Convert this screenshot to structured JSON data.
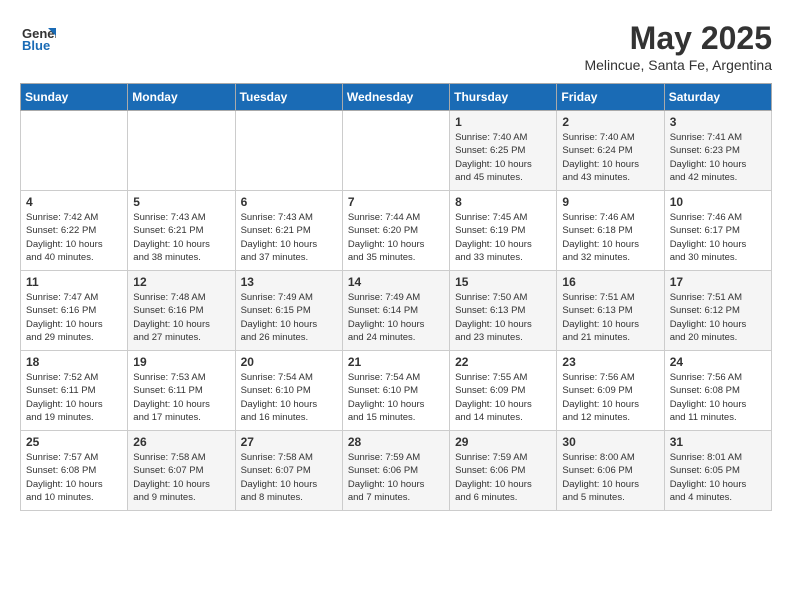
{
  "header": {
    "logo_general": "General",
    "logo_blue": "Blue",
    "title": "May 2025",
    "location": "Melincue, Santa Fe, Argentina"
  },
  "weekdays": [
    "Sunday",
    "Monday",
    "Tuesday",
    "Wednesday",
    "Thursday",
    "Friday",
    "Saturday"
  ],
  "weeks": [
    [
      {
        "day": "",
        "info": ""
      },
      {
        "day": "",
        "info": ""
      },
      {
        "day": "",
        "info": ""
      },
      {
        "day": "",
        "info": ""
      },
      {
        "day": "1",
        "info": "Sunrise: 7:40 AM\nSunset: 6:25 PM\nDaylight: 10 hours\nand 45 minutes."
      },
      {
        "day": "2",
        "info": "Sunrise: 7:40 AM\nSunset: 6:24 PM\nDaylight: 10 hours\nand 43 minutes."
      },
      {
        "day": "3",
        "info": "Sunrise: 7:41 AM\nSunset: 6:23 PM\nDaylight: 10 hours\nand 42 minutes."
      }
    ],
    [
      {
        "day": "4",
        "info": "Sunrise: 7:42 AM\nSunset: 6:22 PM\nDaylight: 10 hours\nand 40 minutes."
      },
      {
        "day": "5",
        "info": "Sunrise: 7:43 AM\nSunset: 6:21 PM\nDaylight: 10 hours\nand 38 minutes."
      },
      {
        "day": "6",
        "info": "Sunrise: 7:43 AM\nSunset: 6:21 PM\nDaylight: 10 hours\nand 37 minutes."
      },
      {
        "day": "7",
        "info": "Sunrise: 7:44 AM\nSunset: 6:20 PM\nDaylight: 10 hours\nand 35 minutes."
      },
      {
        "day": "8",
        "info": "Sunrise: 7:45 AM\nSunset: 6:19 PM\nDaylight: 10 hours\nand 33 minutes."
      },
      {
        "day": "9",
        "info": "Sunrise: 7:46 AM\nSunset: 6:18 PM\nDaylight: 10 hours\nand 32 minutes."
      },
      {
        "day": "10",
        "info": "Sunrise: 7:46 AM\nSunset: 6:17 PM\nDaylight: 10 hours\nand 30 minutes."
      }
    ],
    [
      {
        "day": "11",
        "info": "Sunrise: 7:47 AM\nSunset: 6:16 PM\nDaylight: 10 hours\nand 29 minutes."
      },
      {
        "day": "12",
        "info": "Sunrise: 7:48 AM\nSunset: 6:16 PM\nDaylight: 10 hours\nand 27 minutes."
      },
      {
        "day": "13",
        "info": "Sunrise: 7:49 AM\nSunset: 6:15 PM\nDaylight: 10 hours\nand 26 minutes."
      },
      {
        "day": "14",
        "info": "Sunrise: 7:49 AM\nSunset: 6:14 PM\nDaylight: 10 hours\nand 24 minutes."
      },
      {
        "day": "15",
        "info": "Sunrise: 7:50 AM\nSunset: 6:13 PM\nDaylight: 10 hours\nand 23 minutes."
      },
      {
        "day": "16",
        "info": "Sunrise: 7:51 AM\nSunset: 6:13 PM\nDaylight: 10 hours\nand 21 minutes."
      },
      {
        "day": "17",
        "info": "Sunrise: 7:51 AM\nSunset: 6:12 PM\nDaylight: 10 hours\nand 20 minutes."
      }
    ],
    [
      {
        "day": "18",
        "info": "Sunrise: 7:52 AM\nSunset: 6:11 PM\nDaylight: 10 hours\nand 19 minutes."
      },
      {
        "day": "19",
        "info": "Sunrise: 7:53 AM\nSunset: 6:11 PM\nDaylight: 10 hours\nand 17 minutes."
      },
      {
        "day": "20",
        "info": "Sunrise: 7:54 AM\nSunset: 6:10 PM\nDaylight: 10 hours\nand 16 minutes."
      },
      {
        "day": "21",
        "info": "Sunrise: 7:54 AM\nSunset: 6:10 PM\nDaylight: 10 hours\nand 15 minutes."
      },
      {
        "day": "22",
        "info": "Sunrise: 7:55 AM\nSunset: 6:09 PM\nDaylight: 10 hours\nand 14 minutes."
      },
      {
        "day": "23",
        "info": "Sunrise: 7:56 AM\nSunset: 6:09 PM\nDaylight: 10 hours\nand 12 minutes."
      },
      {
        "day": "24",
        "info": "Sunrise: 7:56 AM\nSunset: 6:08 PM\nDaylight: 10 hours\nand 11 minutes."
      }
    ],
    [
      {
        "day": "25",
        "info": "Sunrise: 7:57 AM\nSunset: 6:08 PM\nDaylight: 10 hours\nand 10 minutes."
      },
      {
        "day": "26",
        "info": "Sunrise: 7:58 AM\nSunset: 6:07 PM\nDaylight: 10 hours\nand 9 minutes."
      },
      {
        "day": "27",
        "info": "Sunrise: 7:58 AM\nSunset: 6:07 PM\nDaylight: 10 hours\nand 8 minutes."
      },
      {
        "day": "28",
        "info": "Sunrise: 7:59 AM\nSunset: 6:06 PM\nDaylight: 10 hours\nand 7 minutes."
      },
      {
        "day": "29",
        "info": "Sunrise: 7:59 AM\nSunset: 6:06 PM\nDaylight: 10 hours\nand 6 minutes."
      },
      {
        "day": "30",
        "info": "Sunrise: 8:00 AM\nSunset: 6:06 PM\nDaylight: 10 hours\nand 5 minutes."
      },
      {
        "day": "31",
        "info": "Sunrise: 8:01 AM\nSunset: 6:05 PM\nDaylight: 10 hours\nand 4 minutes."
      }
    ]
  ]
}
